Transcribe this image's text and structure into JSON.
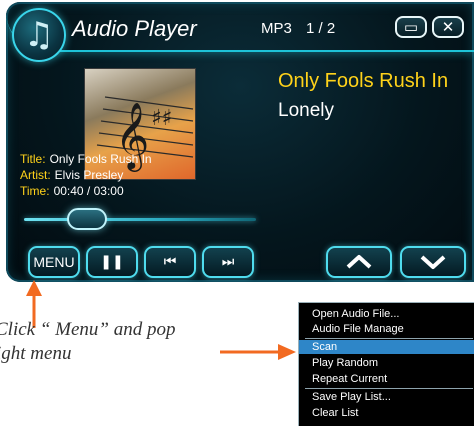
{
  "player": {
    "app_title": "Audio Player",
    "format": "MP3",
    "track_counter": "1 / 2",
    "minimize_icon": "minimize-icon",
    "close_icon": "close-icon",
    "logo_icon": "music-note-icon",
    "now_playing_title": "Only Fools Rush In",
    "now_playing_line2": "Lonely",
    "info": {
      "title_label": "Title:",
      "title_value": "Only Fools Rush In",
      "artist_label": "Artist:",
      "artist_value": "Elvis Presley",
      "time_label": "Time:",
      "time_value": "00:40 / 03:00"
    },
    "seek_progress": 0.22,
    "controls": {
      "menu_label": "MENU",
      "pause_icon": "pause-icon",
      "prev_icon": "previous-track-icon",
      "next_icon": "next-track-icon",
      "up_icon": "chevron-up-icon",
      "down_icon": "chevron-down-icon"
    },
    "colors": {
      "accent_cyan": "#1ec3d8",
      "label_yellow": "#ffd21a",
      "arrow_orange": "#f26a21",
      "menu_highlight": "#2e86c8"
    }
  },
  "annotation": {
    "line1": "Click “ Menu” and pop",
    "line2": "ight menu"
  },
  "context_menu": {
    "items": [
      {
        "label": "Open Audio File...",
        "selected": false
      },
      {
        "label": "Audio File Manage",
        "selected": false
      },
      {
        "label": "Scan",
        "selected": true
      },
      {
        "label": "Play Random",
        "selected": false
      },
      {
        "label": "Repeat Current",
        "selected": false
      },
      {
        "label": "Save Play List...",
        "selected": false
      },
      {
        "label": "Clear List",
        "selected": false
      }
    ]
  }
}
